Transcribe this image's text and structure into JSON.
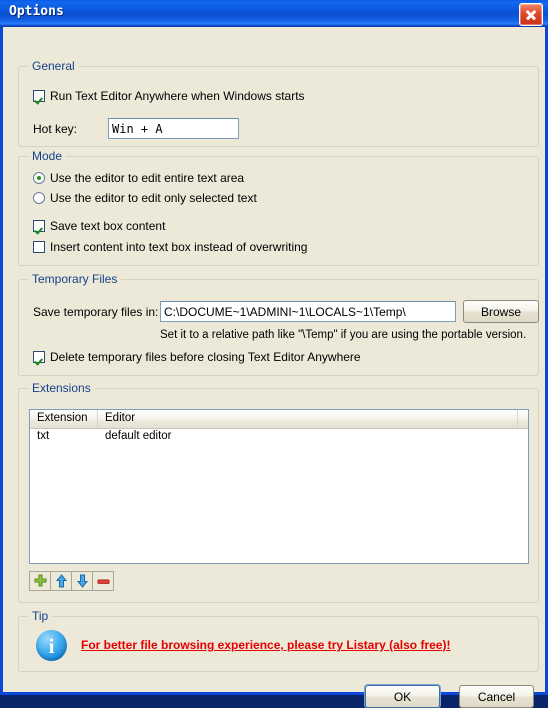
{
  "window": {
    "title": "Options",
    "close_icon": "close-icon"
  },
  "general": {
    "legend": "General",
    "run_on_startup": {
      "label": "Run Text Editor Anywhere when Windows starts",
      "checked": true
    },
    "hotkey_label": "Hot key:",
    "hotkey_value": "Win + A"
  },
  "mode": {
    "legend": "Mode",
    "radio_entire": {
      "label": "Use the editor to edit entire text area",
      "selected": true
    },
    "radio_selected": {
      "label": "Use the editor to edit only selected text",
      "selected": false
    },
    "save_textbox": {
      "label": "Save text box content",
      "checked": true
    },
    "insert_instead": {
      "label": "Insert content into text box instead of overwriting",
      "checked": false
    }
  },
  "temporary_files": {
    "legend": "Temporary Files",
    "path_label": "Save temporary files in:",
    "path_value": "C:\\DOCUME~1\\ADMINI~1\\LOCALS~1\\Temp\\",
    "browse_label": "Browse",
    "hint": "Set it to a relative path like \"\\Temp\" if you are using the portable version.",
    "delete_temp": {
      "label": "Delete temporary files before closing Text Editor Anywhere",
      "checked": true
    }
  },
  "extensions": {
    "legend": "Extensions",
    "columns": [
      "Extension",
      "Editor"
    ],
    "rows": [
      {
        "extension": "txt",
        "editor": "default editor"
      }
    ],
    "toolbar": [
      {
        "name": "add-icon",
        "title": "Add"
      },
      {
        "name": "move-up-icon",
        "title": "Move up"
      },
      {
        "name": "move-down-icon",
        "title": "Move down"
      },
      {
        "name": "remove-icon",
        "title": "Remove"
      }
    ]
  },
  "tip": {
    "legend": "Tip",
    "icon": "info-icon",
    "text": "For better file browsing experience, please try Listary (also free)!"
  },
  "footer": {
    "ok_label": "OK",
    "cancel_label": "Cancel"
  },
  "colors": {
    "titlebar_blue": "#0b56dc",
    "window_frame": "#0c48d8",
    "dialog_bg": "#ece9d8",
    "group_label": "#15428b",
    "tip_red": "#e60000",
    "check_green": "#1a8a1a"
  }
}
